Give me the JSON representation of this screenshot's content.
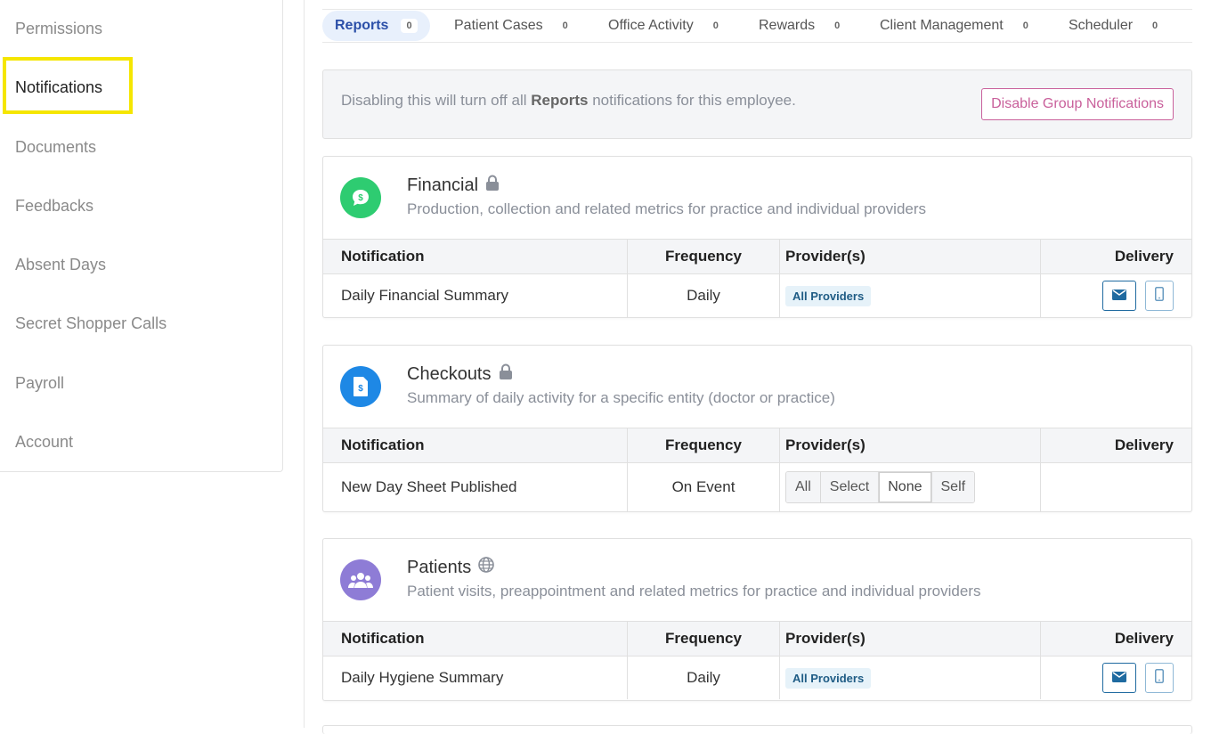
{
  "sidebar": {
    "items": [
      {
        "label": "Permissions"
      },
      {
        "label": "Notifications"
      },
      {
        "label": "Documents"
      },
      {
        "label": "Feedbacks"
      },
      {
        "label": "Absent Days"
      },
      {
        "label": "Secret Shopper Calls"
      },
      {
        "label": "Payroll"
      },
      {
        "label": "Account"
      }
    ],
    "active": "Notifications"
  },
  "tabs": [
    {
      "label": "Reports",
      "count": "0"
    },
    {
      "label": "Patient Cases",
      "count": "0"
    },
    {
      "label": "Office Activity",
      "count": "0"
    },
    {
      "label": "Rewards",
      "count": "0"
    },
    {
      "label": "Client Management",
      "count": "0"
    },
    {
      "label": "Scheduler",
      "count": "0"
    }
  ],
  "banner": {
    "text_before": "Disabling this will turn off all ",
    "group": "Reports",
    "text_after": " notifications for this employee.",
    "button": "Disable Group Notifications"
  },
  "table_headers": {
    "notification": "Notification",
    "frequency": "Frequency",
    "providers": "Provider(s)",
    "delivery": "Delivery"
  },
  "cards": [
    {
      "title": "Financial",
      "title_icon": "lock-icon",
      "icon": "money-chat-icon",
      "icon_color": "#2ecc71",
      "description": "Production, collection and related metrics for practice and individual providers",
      "row": {
        "notification": "Daily Financial Summary",
        "frequency": "Daily",
        "providers": "All Providers"
      }
    },
    {
      "title": "Checkouts",
      "title_icon": "lock-icon",
      "icon": "invoice-icon",
      "icon_color": "#1e88e5",
      "description": "Summary of daily activity for a specific entity (doctor or practice)",
      "row": {
        "notification": "New Day Sheet Published",
        "frequency": "On Event",
        "provider_options": [
          "All",
          "Select",
          "None",
          "Self"
        ],
        "selected": "None"
      }
    },
    {
      "title": "Patients",
      "title_icon": "globe-icon",
      "icon": "users-icon",
      "icon_color": "#8e7cd6",
      "description": "Patient visits, preappointment and related metrics for practice and individual providers",
      "row": {
        "notification": "Daily Hygiene Summary",
        "frequency": "Daily",
        "providers": "All Providers"
      }
    }
  ]
}
